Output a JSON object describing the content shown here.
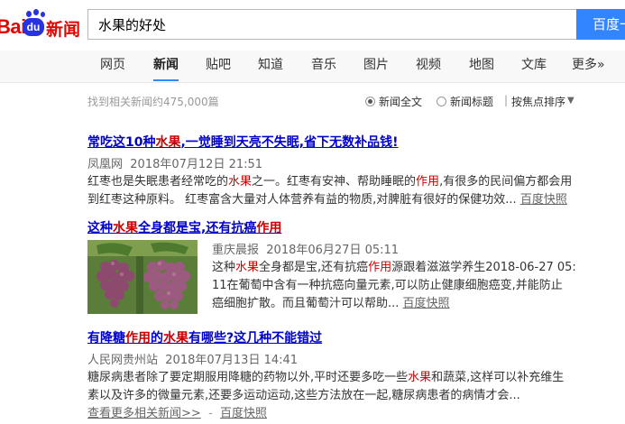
{
  "logo": {
    "bai": "Bai",
    "du": "du",
    "news": "新闻"
  },
  "search": {
    "query": "水果的好处",
    "button_label": "百度一下"
  },
  "nav": {
    "tabs": [
      "网页",
      "新闻",
      "贴吧",
      "知道",
      "音乐",
      "图片",
      "视频",
      "地图",
      "文库",
      "更多»"
    ],
    "active_index": 1
  },
  "toolbar": {
    "result_count": "找到相关新闻约475,000篇",
    "option_full": "新闻全文",
    "option_title": "新闻标题",
    "sort": "按焦点排序"
  },
  "results": [
    {
      "title_parts": [
        "常吃这10种",
        "水果",
        ",一觉睡到天亮不失眠,省下无数补品钱!"
      ],
      "source": "凤凰网",
      "time": "2018年07月12日 21:51",
      "abstract_line1_parts": [
        "红枣也是失眠患者经常吃的",
        "水果",
        "之一。红枣有安神、帮助睡眠的",
        "作用",
        ",有很多的民间偏方都会用"
      ],
      "abstract_line2": "到红枣这种原料。 红枣富含大量对人体营养有益的物质,对脾脏有很好的保健功效...",
      "snapshot": "百度快照"
    },
    {
      "title_parts": [
        "这种",
        "水果",
        "全身都是宝,还有抗癌",
        "作用"
      ],
      "source": "重庆晨报",
      "time": "2018年06月27日 05:11",
      "abstract_line1_parts": [
        "这种",
        "水果",
        "全身都是宝,还有抗癌",
        "作用",
        "源跟着滋滋学养生2018-06-27 05:"
      ],
      "abstract_line2": "11在葡萄中含有一种抗癌向量元素,可以防止健康细胞癌变,并能防止",
      "abstract_line3": "癌细胞扩散。而且葡萄汁可以帮助...",
      "snapshot": "百度快照"
    },
    {
      "title_parts": [
        "有降糖",
        "作用",
        "的",
        "水果",
        "有哪些?这几种不能错过"
      ],
      "source": "人民网贵州站",
      "time": "2018年07月13日 14:41",
      "abstract_line1_parts": [
        "糖尿病患者除了要定期服用降糖的药物以外,平时还要多吃一些",
        "水果",
        "和蔬菜,这样可以补充维生"
      ],
      "abstract_line2": "素以及许多的微量元素,还要多运动运动,这些方法放在一起,糖尿病患者的病情才会...",
      "more_link": "查看更多相关新闻>>",
      "dash": "-",
      "snapshot": "百度快照"
    }
  ],
  "colors": {
    "brand_red": "#e10601",
    "brand_blue": "#2932e1",
    "button_blue": "#3385ff",
    "link_blue": "#0000cc",
    "highlight_red": "#cc0000"
  }
}
